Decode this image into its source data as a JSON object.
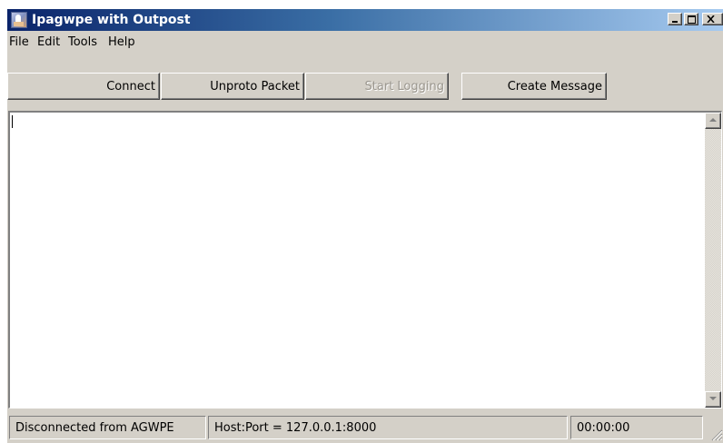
{
  "window": {
    "title": "Ipagwpe with Outpost",
    "icon": "app-icon",
    "controls": [
      "minimize-icon",
      "maximize-icon",
      "close-icon"
    ]
  },
  "menu": {
    "items": [
      "File",
      "Edit",
      "Tools",
      "Help"
    ]
  },
  "toolbar": {
    "connect_label": "Connect",
    "unproto_label": "Unproto Packet",
    "start_logging_label": "Start Logging",
    "start_logging_enabled": false,
    "create_message_label": "Create Message"
  },
  "text_area": {
    "content": ""
  },
  "status": {
    "connection": "Disconnected from AGWPE",
    "host_port": "Host:Port = 127.0.0.1:8000",
    "elapsed": "00:00:00"
  }
}
